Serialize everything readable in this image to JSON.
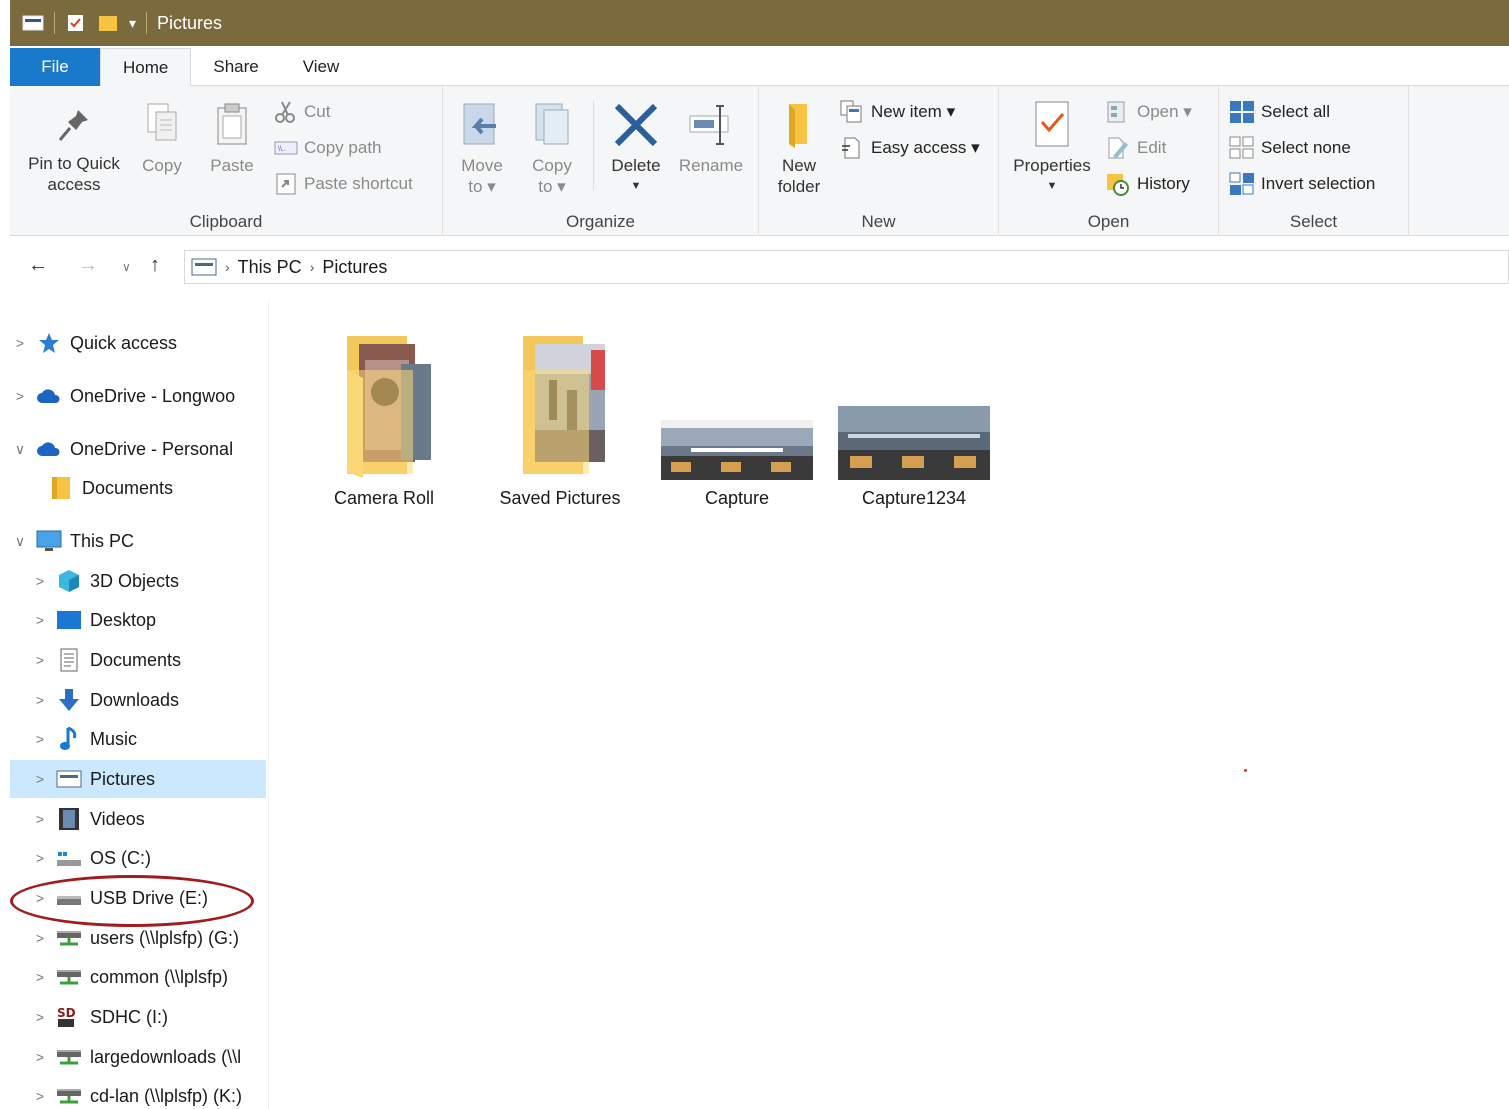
{
  "window": {
    "title": "Pictures"
  },
  "ribbon_tabs": [
    "File",
    "Home",
    "Share",
    "View"
  ],
  "clipboard": {
    "label": "Clipboard",
    "pin": [
      "Pin to Quick",
      "access"
    ],
    "copy": "Copy",
    "paste": "Paste",
    "cut": "Cut",
    "copy_path": "Copy path",
    "paste_shortcut": "Paste shortcut"
  },
  "organize": {
    "label": "Organize",
    "move_to": [
      "Move",
      "to ▾"
    ],
    "copy_to": [
      "Copy",
      "to ▾"
    ],
    "delete": "Delete",
    "rename": "Rename"
  },
  "new": {
    "label": "New",
    "new_folder": [
      "New",
      "folder"
    ],
    "new_item": "New item ▾",
    "easy_access": "Easy access ▾"
  },
  "open": {
    "label": "Open",
    "properties": "Properties",
    "open": "Open ▾",
    "edit": "Edit",
    "history": "History"
  },
  "select": {
    "label": "Select",
    "select_all": "Select all",
    "select_none": "Select none",
    "invert": "Invert selection"
  },
  "address": {
    "crumbs": [
      "This PC",
      "Pictures"
    ]
  },
  "sidebar": {
    "items": [
      {
        "label": "Quick access",
        "icon": "star-icon"
      },
      {
        "label": "OneDrive - Longwoo",
        "icon": "cloud-icon"
      },
      {
        "label": "OneDrive - Personal",
        "icon": "cloud-icon"
      },
      {
        "label": "Documents",
        "icon": "folder-icon"
      },
      {
        "label": "This PC",
        "icon": "computer-icon"
      },
      {
        "label": "3D Objects",
        "icon": "cube-icon"
      },
      {
        "label": "Desktop",
        "icon": "desktop-icon"
      },
      {
        "label": "Documents",
        "icon": "document-icon"
      },
      {
        "label": "Downloads",
        "icon": "download-icon"
      },
      {
        "label": "Music",
        "icon": "music-icon"
      },
      {
        "label": "Pictures",
        "icon": "pictures-icon"
      },
      {
        "label": "Videos",
        "icon": "video-icon"
      },
      {
        "label": "OS (C:)",
        "icon": "drive-icon"
      },
      {
        "label": "USB Drive (E:)",
        "icon": "usb-drive-icon"
      },
      {
        "label": "users (\\\\lplsfp) (G:)",
        "icon": "network-drive-icon"
      },
      {
        "label": "common (\\\\lplsfp)",
        "icon": "network-drive-icon"
      },
      {
        "label": "SDHC (I:)",
        "icon": "sd-card-icon"
      },
      {
        "label": "largedownloads (\\\\l",
        "icon": "network-drive-icon"
      },
      {
        "label": "cd-lan (\\\\lplsfp) (K:)",
        "icon": "network-drive-icon"
      }
    ]
  },
  "files": [
    {
      "name": "Camera Roll",
      "type": "folder"
    },
    {
      "name": "Saved Pictures",
      "type": "folder"
    },
    {
      "name": "Capture",
      "type": "image"
    },
    {
      "name": "Capture1234",
      "type": "image"
    }
  ],
  "colors": {
    "title_bar": "#7a6a3e",
    "file_tab": "#1979ca",
    "selection": "#cce8ff",
    "annotation_circle": "#a11c1c"
  }
}
